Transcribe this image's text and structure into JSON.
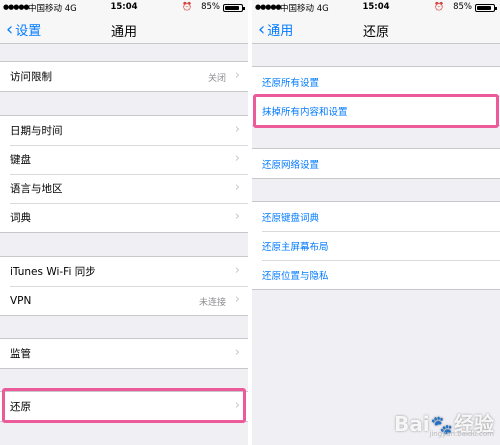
{
  "status": {
    "carrier": "中国移动",
    "network": "4G",
    "time": "15:04",
    "battery": "85%"
  },
  "left": {
    "back_label": "设置",
    "title": "通用",
    "groups": [
      [
        {
          "label": "访问限制",
          "detail": "关闭"
        }
      ],
      [
        {
          "label": "日期与时间"
        },
        {
          "label": "键盘"
        },
        {
          "label": "语言与地区"
        },
        {
          "label": "词典"
        }
      ],
      [
        {
          "label": "iTunes Wi-Fi 同步"
        },
        {
          "label": "VPN",
          "detail": "未连接"
        }
      ],
      [
        {
          "label": "监管"
        }
      ],
      [
        {
          "label": "还原"
        }
      ]
    ]
  },
  "right": {
    "back_label": "通用",
    "title": "还原",
    "groups": [
      [
        {
          "label": "还原所有设置"
        },
        {
          "label": "抹掉所有内容和设置"
        }
      ],
      [
        {
          "label": "还原网络设置"
        }
      ],
      [
        {
          "label": "还原键盘词典"
        },
        {
          "label": "还原主屏幕布局"
        },
        {
          "label": "还原位置与隐私"
        }
      ]
    ]
  },
  "icons": {
    "back": "chevron-left-icon",
    "row_arrow": "chevron-right-icon",
    "alarm": "alarm-clock-icon",
    "battery": "battery-icon"
  },
  "colors": {
    "accent": "#007aff",
    "highlight": "#ec5a9a",
    "background": "#efeff4"
  },
  "watermark": {
    "text_left": "Bai",
    "text_right": "经验",
    "url": "jingyan.baidu.com"
  }
}
